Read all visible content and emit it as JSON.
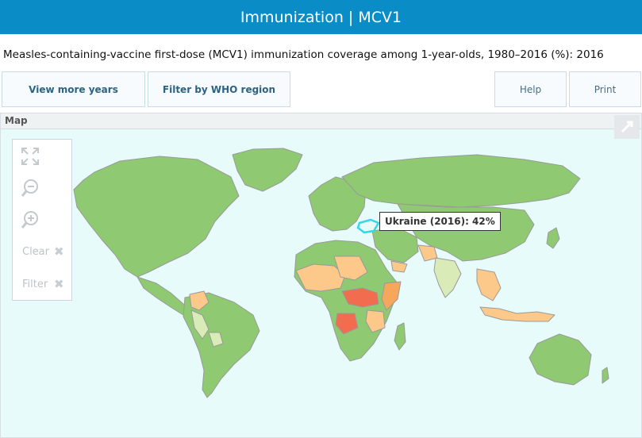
{
  "header": {
    "title": "Immunization | MCV1"
  },
  "subtitle": "Measles-containing-vaccine first-dose (MCV1) immunization coverage among 1-year-olds, 1980–2016 (%): 2016",
  "toolbar": {
    "view_more_years": "View more years",
    "filter_by_region": "Filter by WHO region",
    "help": "Help",
    "print": "Print"
  },
  "map_panel": {
    "title": "Map",
    "tools": {
      "clear_label": "Clear",
      "filter_label": "Filter"
    },
    "tooltip": "Ukraine (2016): 42%"
  },
  "map": {
    "highlighted_country": "Ukraine",
    "highlighted_year": 2016,
    "highlighted_value_percent": 42,
    "colors": {
      "ocean": "#e8fbfb",
      "high_coverage": "#8fc972",
      "mid_coverage": "#fdc98a",
      "lower_coverage": "#f7a75c",
      "low_coverage": "#f26d4f",
      "light_band": "#d9ebb7",
      "highlight_outline": "#34d8e8",
      "borders": "#9a9a9a"
    }
  }
}
